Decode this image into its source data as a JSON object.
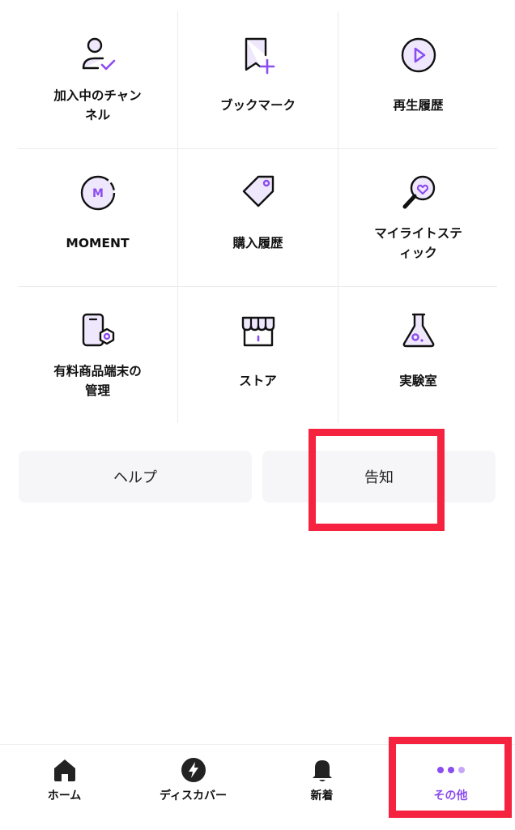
{
  "grid": {
    "items": [
      {
        "label": "加入中のチャン\nネル",
        "icon": "subscribed-user-icon"
      },
      {
        "label": "ブックマーク",
        "icon": "bookmark-add-icon"
      },
      {
        "label": "再生履歴",
        "icon": "play-history-icon"
      },
      {
        "label": "MOMENT",
        "icon": "moment-icon"
      },
      {
        "label": "購入履歴",
        "icon": "purchase-tag-icon"
      },
      {
        "label": "マイライトステ\nィック",
        "icon": "lightstick-icon"
      },
      {
        "label": "有料商品端末の\n管理",
        "icon": "device-management-icon"
      },
      {
        "label": "ストア",
        "icon": "store-icon"
      },
      {
        "label": "実験室",
        "icon": "flask-icon"
      }
    ]
  },
  "buttons": {
    "help": "ヘルプ",
    "notice": "告知"
  },
  "tabbar": {
    "items": [
      {
        "label": "ホーム",
        "icon": "home-icon"
      },
      {
        "label": "ディスカバー",
        "icon": "lightning-icon"
      },
      {
        "label": "新着",
        "icon": "bell-icon"
      },
      {
        "label": "その他",
        "icon": "more-dots-icon",
        "active": true
      }
    ]
  },
  "colors": {
    "accent": "#8b4cf0",
    "accent_light": "#efe8fd",
    "highlight": "#f5233f"
  }
}
